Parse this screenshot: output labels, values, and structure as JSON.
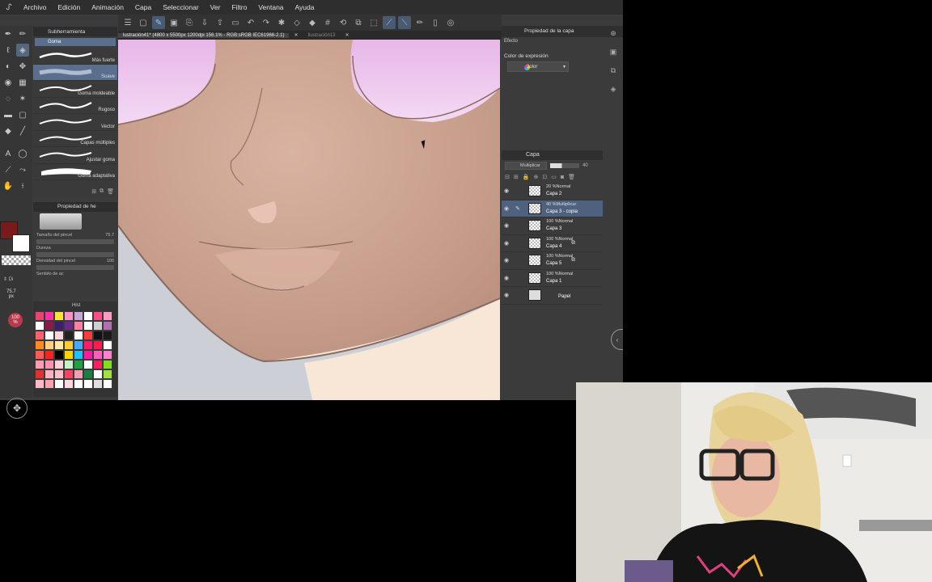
{
  "menu": {
    "items": [
      "Archivo",
      "Edición",
      "Animación",
      "Capa",
      "Seleccionar",
      "Ver",
      "Filtro",
      "Ventana",
      "Ayuda"
    ]
  },
  "document_tabs": [
    {
      "label": "lustración41* (4800 x 5500px 1200dpi 156.1% - RGB:sRGB IEC61966-2.1)",
      "active": true
    },
    {
      "label": "Ilustración13",
      "active": false
    }
  ],
  "subtool": {
    "header": "Subherramienta",
    "tab": "Goma",
    "brushes": [
      {
        "label": "Más fuerte",
        "selected": false
      },
      {
        "label": "Suave",
        "selected": true
      },
      {
        "label": "Goma moldeable",
        "selected": false
      },
      {
        "label": "Rugoso",
        "selected": false
      },
      {
        "label": "Vector",
        "selected": false
      },
      {
        "label": "Capas múltiples",
        "selected": false
      },
      {
        "label": "Ajustar goma",
        "selected": false
      },
      {
        "label": "Goma adaptativa",
        "selected": false
      }
    ]
  },
  "tool_property": {
    "header": "Propiedad de he",
    "preview_label": "Suave",
    "size_label": "Tamaño del pincel",
    "size_value": "75.7",
    "hardness_label": "Dureza",
    "density_label": "Densidad del pincel",
    "density_value": "100",
    "sense_label": "Sentido de ac"
  },
  "left_indicators": {
    "size_value": "75.7",
    "size_unit": "px",
    "opacity_value": "100",
    "opacity_unit": "%"
  },
  "palette": {
    "header": "Hist",
    "colors": [
      "#e8446e",
      "#ff2fa8",
      "#ffe23a",
      "#ff8fc5",
      "#c9a6d8",
      "#ffffff",
      "#ff4d8a",
      "#ff9ac2",
      "#ffffff",
      "#8a1a4a",
      "#3a1f6e",
      "#6a2a8a",
      "#ff80a0",
      "#ffffff",
      "#d0d0d0",
      "#b070b0",
      "#ff6070",
      "#ffffff",
      "#ffd6e0",
      "#222222",
      "#ffffff",
      "#ff3a3a",
      "#111111",
      "#1a1a1a",
      "#ff8a20",
      "#ffd080",
      "#ffe8a0",
      "#ffcc33",
      "#44aaff",
      "#ff1a6a",
      "#ff1a50",
      "#ffffff",
      "#ff5a5a",
      "#ff2020",
      "#000000",
      "#ffd200",
      "#20c0ff",
      "#ff1aa0",
      "#ff60c0",
      "#ff80d0",
      "#ff9ab0",
      "#ff90b0",
      "#ffd0d8",
      "#c8f0c8",
      "#20a040",
      "#ffffff",
      "#ff2060",
      "#80e020",
      "#e03030",
      "#ffb0c0",
      "#ffc0c8",
      "#ff4060",
      "#f0a0b0",
      "#1a8040",
      "#ffffff",
      "#a0e040",
      "#ffb8c8",
      "#ffa0b0",
      "#ffffff",
      "#ffd8e0",
      "#ffffff",
      "#ffffff",
      "#e0e0e0",
      "#ffffff"
    ]
  },
  "right": {
    "prop_header": "Propiedad de la capa",
    "efecto": "Efecto",
    "expression_label": "Color de expresión",
    "expression_value": "Color"
  },
  "layers": {
    "header": "Capa",
    "blend_mode": "Multiplicar",
    "opacity": "40",
    "items": [
      {
        "mode": "20 %Normal",
        "name": "Capa 2",
        "selected": false,
        "group": false
      },
      {
        "mode": "40 %Multiplicar",
        "name": "Capa 3 - copia",
        "selected": true,
        "group": false
      },
      {
        "mode": "100 %Normal",
        "name": "Capa 3",
        "selected": false,
        "group": false
      },
      {
        "mode": "100 %Normal",
        "name": "Capa 4",
        "selected": false,
        "group": true
      },
      {
        "mode": "100 %Normal",
        "name": "Capa 5",
        "selected": false,
        "group": true
      },
      {
        "mode": "100 %Normal",
        "name": "Capa 1",
        "selected": false,
        "group": false
      },
      {
        "mode": "",
        "name": "Papel",
        "selected": false,
        "group": false,
        "paper": true
      }
    ]
  },
  "icons": {
    "app_logo": "clip-studio-icon",
    "cursor": "pointer-cursor-icon"
  }
}
